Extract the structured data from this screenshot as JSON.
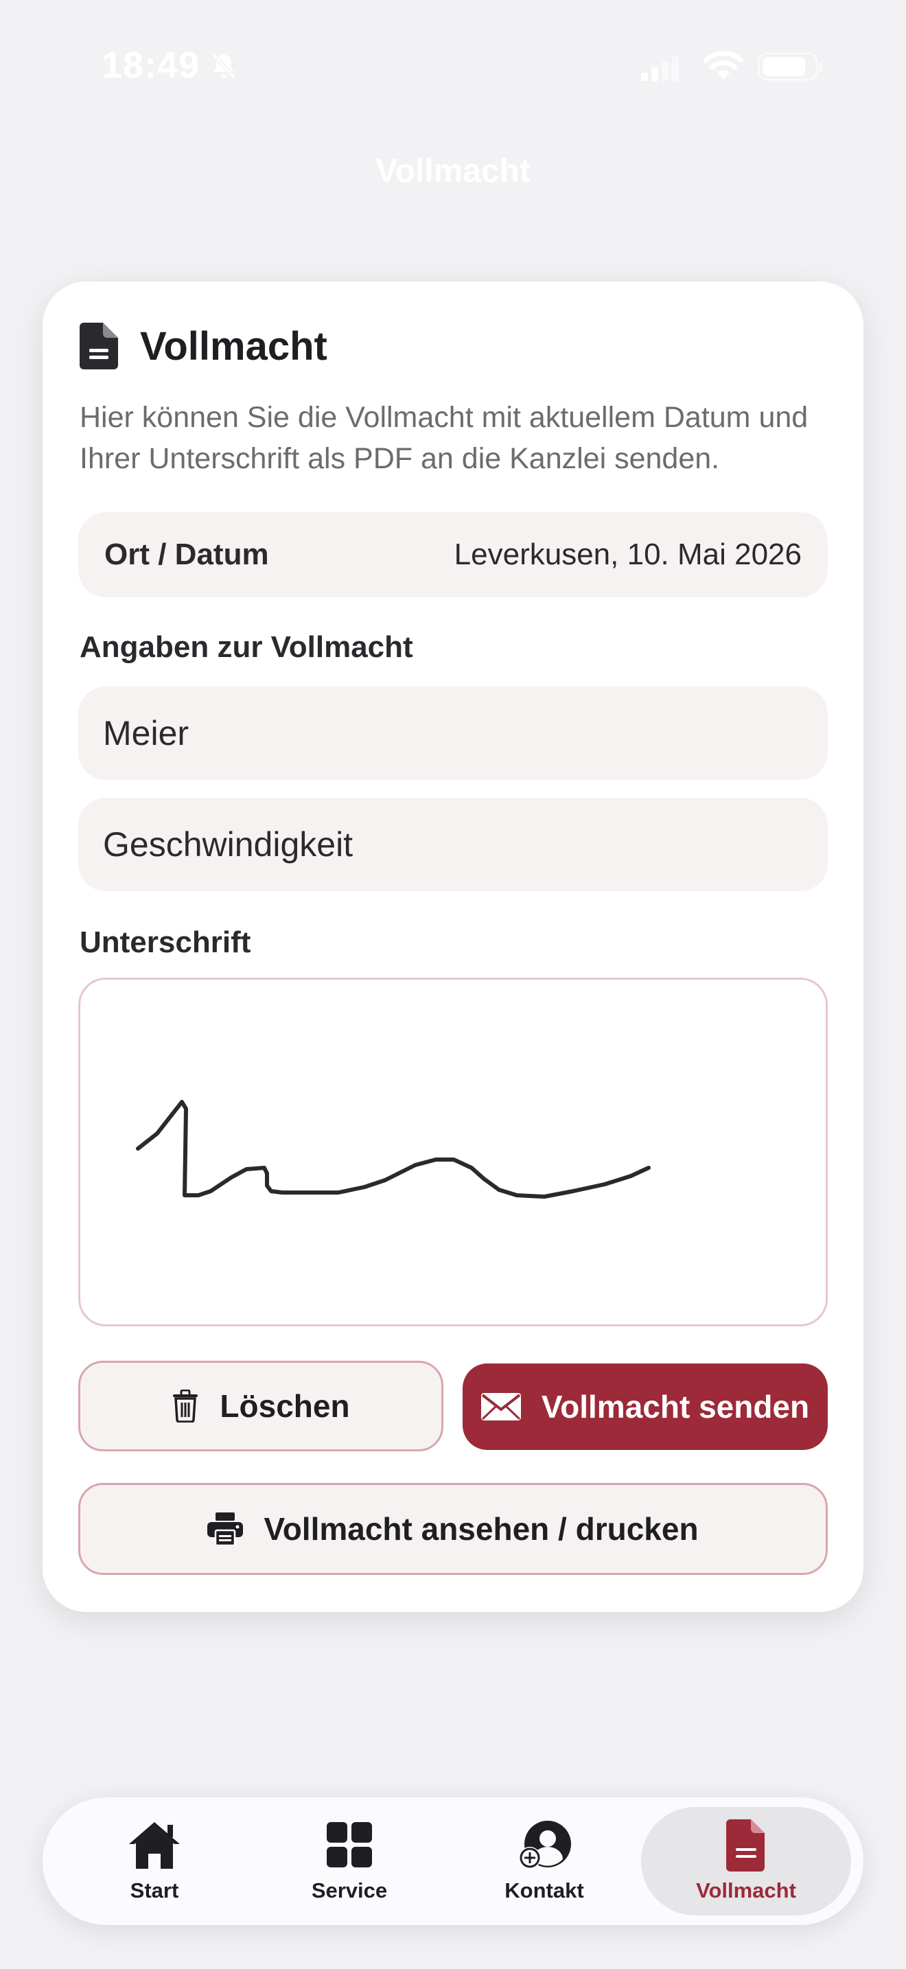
{
  "status_bar": {
    "time": "18:49",
    "icons": [
      "bell-slash-icon",
      "signal-icon",
      "wifi-icon",
      "battery-icon"
    ]
  },
  "nav": {
    "title": "Vollmacht"
  },
  "card": {
    "icon": "document-icon",
    "title": "Vollmacht",
    "description": "Hier können Sie die Vollmacht mit aktuellem Datum und Ihrer Unterschrift als PDF an die Kanzlei senden.",
    "date_row": {
      "label": "Ort / Datum",
      "value": "Leverkusen, 10. Mai 2026"
    },
    "details": {
      "label": "Angaben zur Vollmacht",
      "field_1_value": "Meier",
      "field_2_value": "Geschwindigkeit"
    },
    "signature": {
      "label": "Unterschrift"
    },
    "buttons": {
      "clear": "Löschen",
      "send": "Vollmacht senden",
      "print": "Vollmacht ansehen / drucken"
    }
  },
  "tab_bar": {
    "items": [
      {
        "label": "Start",
        "icon": "home-icon"
      },
      {
        "label": "Service",
        "icon": "grid-icon"
      },
      {
        "label": "Kontakt",
        "icon": "contact-add-icon"
      },
      {
        "label": "Vollmacht",
        "icon": "document-icon",
        "active": true
      }
    ]
  },
  "colors": {
    "accent": "#9c2a39",
    "background": "#f2f2f5",
    "field_bg": "#f7f2f2",
    "border": "#d9a6ad"
  }
}
